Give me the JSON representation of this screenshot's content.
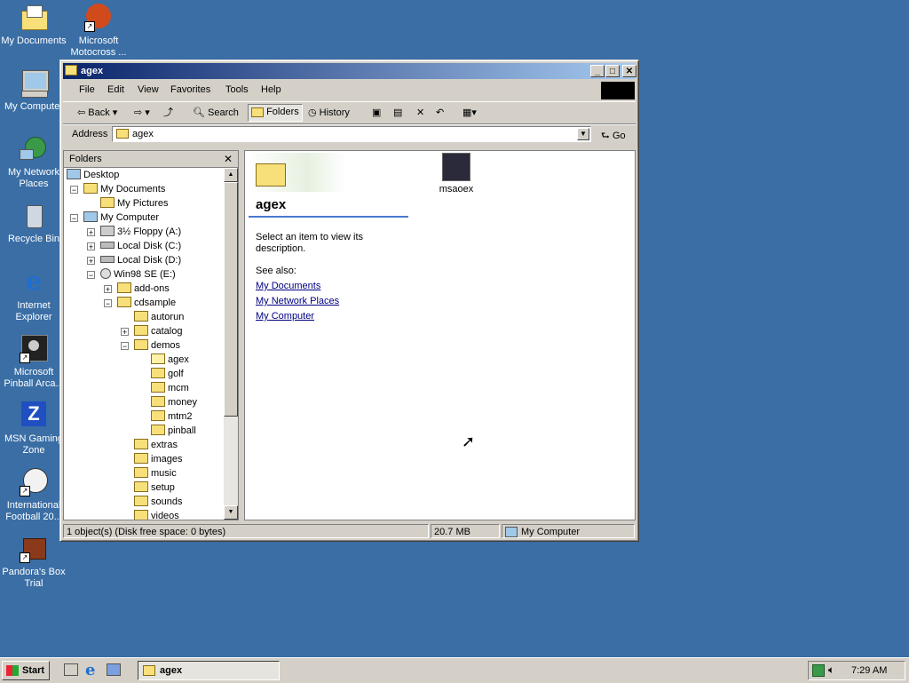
{
  "desktop": {
    "icons": [
      {
        "label": "My Documents"
      },
      {
        "label": "Microsoft Motocross ..."
      },
      {
        "label": "My Computer"
      },
      {
        "label": "My Network Places"
      },
      {
        "label": "Recycle Bin"
      },
      {
        "label": "Internet Explorer"
      },
      {
        "label": "Microsoft Pinball Arca..."
      },
      {
        "label": "MSN Gaming Zone"
      },
      {
        "label": "International Football 20..."
      },
      {
        "label": "Pandora's Box Trial"
      }
    ]
  },
  "window": {
    "title": "agex",
    "menu": [
      "File",
      "Edit",
      "View",
      "Favorites",
      "Tools",
      "Help"
    ],
    "toolbar": {
      "back": "Back",
      "search": "Search",
      "folders": "Folders",
      "history": "History"
    },
    "address": {
      "label": "Address",
      "value": "agex",
      "go": "Go"
    },
    "folders_pane": {
      "title": "Folders",
      "tree": [
        {
          "label": "Desktop"
        },
        {
          "label": "My Documents"
        },
        {
          "label": "My Pictures"
        },
        {
          "label": "My Computer"
        },
        {
          "label": "3½ Floppy (A:)"
        },
        {
          "label": "Local Disk (C:)"
        },
        {
          "label": "Local Disk (D:)"
        },
        {
          "label": "Win98 SE (E:)"
        },
        {
          "label": "add-ons"
        },
        {
          "label": "cdsample"
        },
        {
          "label": "autorun"
        },
        {
          "label": "catalog"
        },
        {
          "label": "demos"
        },
        {
          "label": "agex"
        },
        {
          "label": "golf"
        },
        {
          "label": "mcm"
        },
        {
          "label": "money"
        },
        {
          "label": "mtm2"
        },
        {
          "label": "pinball"
        },
        {
          "label": "extras"
        },
        {
          "label": "images"
        },
        {
          "label": "music"
        },
        {
          "label": "setup"
        },
        {
          "label": "sounds"
        },
        {
          "label": "videos"
        }
      ]
    },
    "content": {
      "folder_name": "agex",
      "description": "Select an item to view its description.",
      "see_also": "See also:",
      "links": [
        "My Documents",
        "My Network Places",
        "My Computer"
      ],
      "files": [
        {
          "label": "msaoex"
        }
      ]
    },
    "status": {
      "objects": "1 object(s) (Disk free space: 0 bytes)",
      "size": "20.7 MB",
      "zone": "My Computer"
    }
  },
  "taskbar": {
    "start": "Start",
    "task": "agex",
    "clock": "7:29 AM"
  }
}
